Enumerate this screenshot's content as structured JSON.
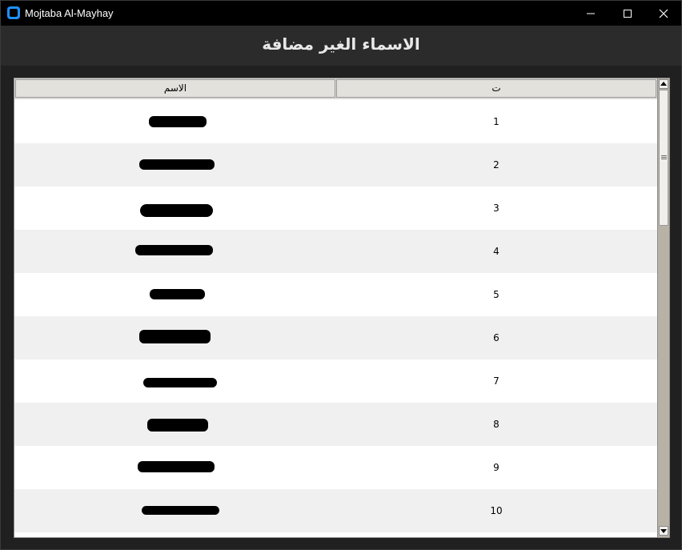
{
  "window": {
    "title": "Mojtaba Al-Mayhay",
    "icon": "app-icon",
    "controls": [
      "minimize-icon",
      "maximize-icon",
      "close-icon"
    ]
  },
  "header": {
    "title": "الاسماء الغير  مضافة"
  },
  "table": {
    "columns": [
      "الاسم",
      "ت"
    ],
    "rows": [
      {
        "name": "",
        "number": "1"
      },
      {
        "name": "",
        "number": "2"
      },
      {
        "name": "",
        "number": "3"
      },
      {
        "name": "",
        "number": "4"
      },
      {
        "name": "",
        "number": "5"
      },
      {
        "name": "",
        "number": "6"
      },
      {
        "name": "",
        "number": "7"
      },
      {
        "name": "",
        "number": "8"
      },
      {
        "name": "",
        "number": "9"
      },
      {
        "name": "",
        "number": "10"
      }
    ]
  },
  "scrollbar": {
    "icons": [
      "scroll-up-icon",
      "scroll-down-icon"
    ],
    "position_fraction": 0
  },
  "colors": {
    "titlebar": "#000000",
    "header_bg": "#2b2b2b",
    "row_alt": "#f0f0f0",
    "scroll_track": "#b8b2a6"
  }
}
